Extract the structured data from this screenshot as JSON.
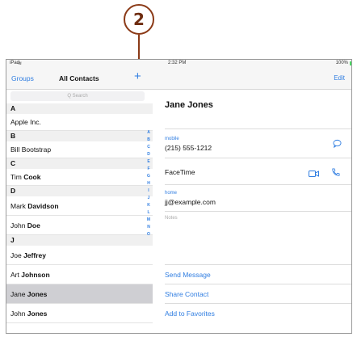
{
  "callout": {
    "number": "2"
  },
  "status": {
    "device": "iPad",
    "time": "2:32 PM",
    "battery": "100%"
  },
  "left": {
    "groups_label": "Groups",
    "title": "All Contacts",
    "add_label": "+",
    "search_placeholder": "Q Search",
    "rows": [
      {
        "type": "section",
        "first": "A",
        "last": ""
      },
      {
        "type": "contact",
        "first": "Apple Inc.",
        "last": ""
      },
      {
        "type": "section",
        "first": "B",
        "last": ""
      },
      {
        "type": "contact",
        "first": "Bill Bootstrap",
        "last": ""
      },
      {
        "type": "section",
        "first": "C",
        "last": ""
      },
      {
        "type": "contact",
        "first": "Tim ",
        "last": "Cook"
      },
      {
        "type": "section",
        "first": "D",
        "last": ""
      },
      {
        "type": "contact",
        "first": "Mark ",
        "last": "Davidson"
      },
      {
        "type": "contact",
        "first": "John ",
        "last": "Doe"
      },
      {
        "type": "section",
        "first": "J",
        "last": ""
      },
      {
        "type": "contact",
        "first": "Joe ",
        "last": "Jeffrey"
      },
      {
        "type": "contact",
        "first": "Art ",
        "last": "Johnson"
      },
      {
        "type": "contact",
        "first": "Jane ",
        "last": "Jones",
        "selected": true
      },
      {
        "type": "contact",
        "first": "John ",
        "last": "Jones"
      }
    ],
    "index": [
      "A",
      "B",
      "C",
      "D",
      "E",
      "F",
      "G",
      "H",
      "I",
      "J",
      "K",
      "L",
      "M",
      "N",
      "O"
    ]
  },
  "right": {
    "edit_label": "Edit",
    "name": "Jane Jones",
    "mobile_label": "mobile",
    "mobile_value": "(215) 555-1212",
    "facetime_label": "FaceTime",
    "home_label": "home",
    "home_value": "jj@example.com",
    "notes_label": "Notes",
    "actions": [
      "Send Message",
      "Share Contact",
      "Add to Favorites"
    ]
  },
  "colors": {
    "accent": "#2f7de1",
    "callout": "#8b3a17",
    "selected": "#cfcfd3"
  }
}
